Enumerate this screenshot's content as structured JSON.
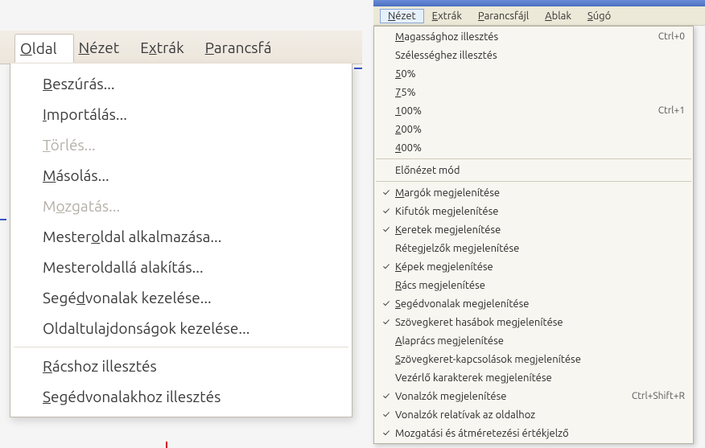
{
  "left": {
    "menubar": [
      {
        "label": "Oldal",
        "accel_index": 0,
        "open": true
      },
      {
        "label": "Nézet",
        "accel_index": 0,
        "open": false
      },
      {
        "label": "Extrák",
        "accel_index": 1,
        "open": false
      },
      {
        "label": "Parancsfájl",
        "accel_index": 0,
        "open": false,
        "truncated": "Parancsfá"
      }
    ],
    "dropdown": [
      {
        "label": "Beszúrás...",
        "accel_index": 0,
        "disabled": false
      },
      {
        "label": "Importálás...",
        "accel_index": 0,
        "disabled": false
      },
      {
        "label": "Törlés...",
        "accel_index": 0,
        "disabled": true
      },
      {
        "label": "Másolás...",
        "accel_index": 0,
        "disabled": false
      },
      {
        "label": "Mozgatás...",
        "accel_index": 1,
        "disabled": true
      },
      {
        "label": "Mesteroldal alkalmazása...",
        "accel_index": 6,
        "disabled": false
      },
      {
        "label": "Mesteroldallá alakítás...",
        "accel_index": -1,
        "disabled": false
      },
      {
        "label": "Segédvonalak kezelése...",
        "accel_index": 4,
        "disabled": false
      },
      {
        "label": "Oldaltulajdonságok kezelése...",
        "accel_index": -1,
        "disabled": false
      },
      {
        "sep": true
      },
      {
        "label": "Rácshoz illesztés",
        "accel_index": 0,
        "disabled": false
      },
      {
        "label": "Segédvonalakhoz illesztés",
        "accel_index": 0,
        "disabled": false
      }
    ]
  },
  "right": {
    "menubar": [
      {
        "label": "Nézet",
        "accel_index": 0,
        "open": true
      },
      {
        "label": "Extrák",
        "accel_index": 0,
        "open": false
      },
      {
        "label": "Parancsfájl",
        "accel_index": 0,
        "open": false
      },
      {
        "label": "Ablak",
        "accel_index": 0,
        "open": false
      },
      {
        "label": "Súgó",
        "accel_index": 0,
        "open": false
      }
    ],
    "dropdown": [
      {
        "label": "Magassághoz illesztés",
        "accel_index": 0,
        "shortcut": "Ctrl+0"
      },
      {
        "label": "Szélességhez illesztés",
        "accel_index": -1
      },
      {
        "label": "50%",
        "accel_index": 0
      },
      {
        "label": "75%",
        "accel_index": 0
      },
      {
        "label": "100%",
        "accel_index": 0,
        "shortcut": "Ctrl+1"
      },
      {
        "label": "200%",
        "accel_index": 0
      },
      {
        "label": "400%",
        "accel_index": 0
      },
      {
        "sep": true
      },
      {
        "label": "Előnézet mód",
        "accel_index": -1
      },
      {
        "sep": true
      },
      {
        "label": "Margók megjelenítése",
        "accel_index": 0,
        "checked": true
      },
      {
        "label": "Kifutók megjelenítése",
        "accel_index": -1,
        "checked": true
      },
      {
        "label": "Keretek megjelenítése",
        "accel_index": 0,
        "checked": true
      },
      {
        "label": "Rétegjelzők megjelenítése",
        "accel_index": -1,
        "checked": false
      },
      {
        "label": "Képek megjelenítése",
        "accel_index": 0,
        "checked": true
      },
      {
        "label": "Rács megjelenítése",
        "accel_index": 0,
        "checked": false
      },
      {
        "label": "Segédvonalak megjelenítése",
        "accel_index": 0,
        "checked": true
      },
      {
        "label": "Szövegkeret hasábok megjelenítése",
        "accel_index": -1,
        "checked": true
      },
      {
        "label": "Alaprács megjelenítése",
        "accel_index": 0,
        "checked": false
      },
      {
        "label": "Szövegkeret-kapcsolások megjelenítése",
        "accel_index": 0,
        "checked": false
      },
      {
        "label": "Vezérlő karakterek megjelenítése",
        "accel_index": -1,
        "checked": false
      },
      {
        "label": "Vonalzók megjelenítése",
        "accel_index": -1,
        "checked": true,
        "shortcut": "Ctrl+Shift+R"
      },
      {
        "label": "Vonalzók relatívak az oldalhoz",
        "accel_index": -1,
        "checked": true
      },
      {
        "label": "Mozgatási és átméretezési értékjelző",
        "accel_index": -1,
        "checked": true
      }
    ]
  }
}
